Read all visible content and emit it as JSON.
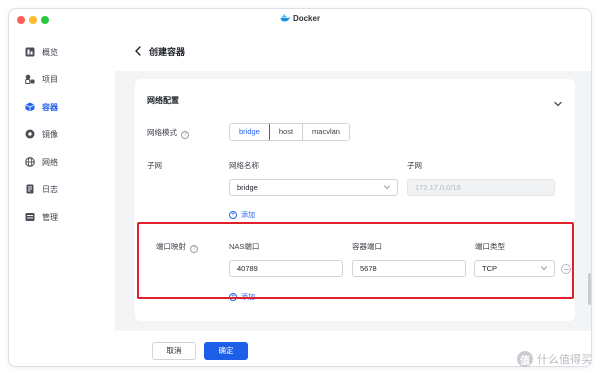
{
  "window": {
    "title": "Docker"
  },
  "sidebar": {
    "items": [
      {
        "label": "概览",
        "icon": "overview-icon",
        "active": false
      },
      {
        "label": "项目",
        "icon": "project-icon",
        "active": false
      },
      {
        "label": "容器",
        "icon": "container-icon",
        "active": true
      },
      {
        "label": "镜像",
        "icon": "image-icon",
        "active": false
      },
      {
        "label": "网络",
        "icon": "network-icon",
        "active": false
      },
      {
        "label": "日志",
        "icon": "log-icon",
        "active": false
      },
      {
        "label": "管理",
        "icon": "manage-icon",
        "active": false
      }
    ]
  },
  "header": {
    "title": "创建容器"
  },
  "network_config": {
    "title": "网络配置",
    "mode_label": "网络模式",
    "modes": [
      "bridge",
      "host",
      "macvlan"
    ],
    "selected_mode": "bridge",
    "subnet_label": "子网",
    "network_name_header": "网络名称",
    "subnet_header": "子网",
    "network_name_value": "bridge",
    "subnet_placeholder": "172.17.0.0/16",
    "add_label": "添加"
  },
  "port_mapping": {
    "label": "端口映射",
    "headers": {
      "nas_port": "NAS端口",
      "container_port": "容器端口",
      "port_type": "端口类型"
    },
    "rows": [
      {
        "nas_port": "40789",
        "container_port": "5678",
        "port_type": "TCP"
      }
    ],
    "add_label": "添加"
  },
  "footer": {
    "cancel_label": "取消",
    "confirm_label": "确定"
  },
  "colors": {
    "accent": "#1d5ee8",
    "highlight": "#e0202a"
  },
  "watermark": {
    "badge": "值",
    "text": "什么值得买"
  }
}
